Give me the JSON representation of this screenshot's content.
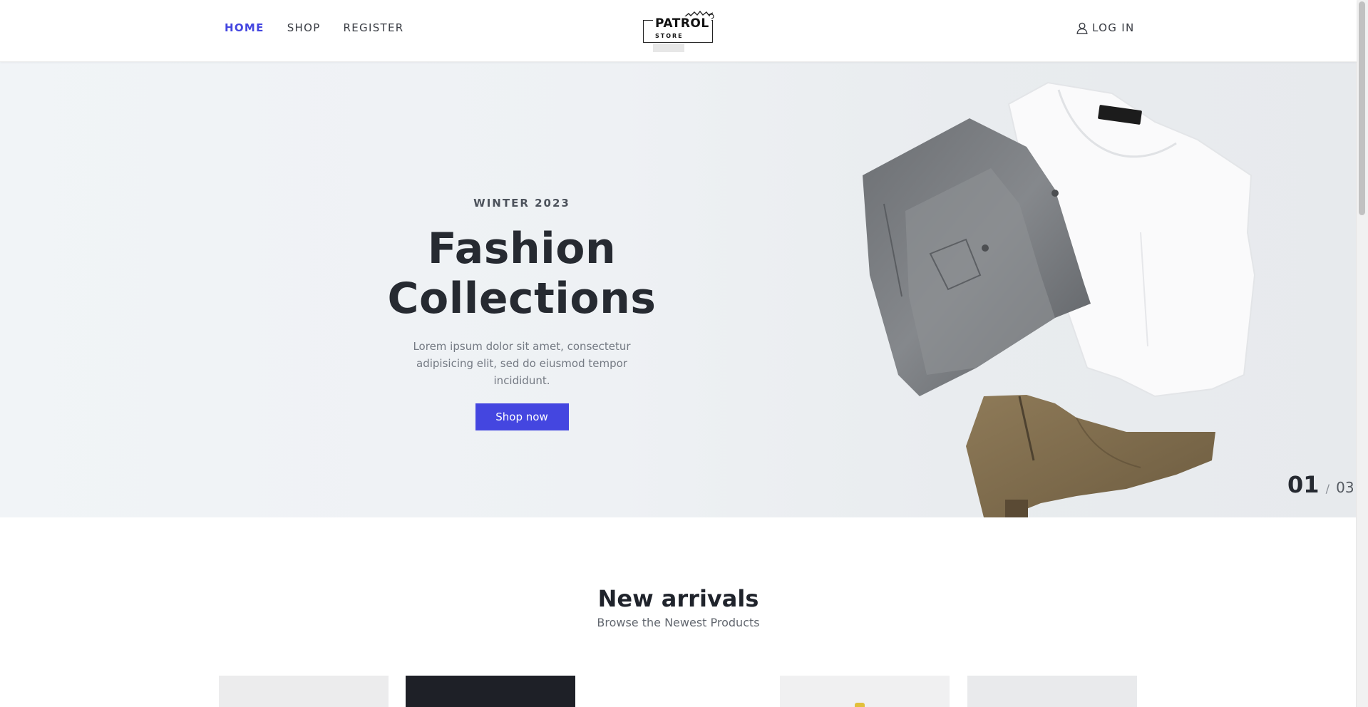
{
  "nav": {
    "items": [
      {
        "label": "HOME",
        "active": true
      },
      {
        "label": "SHOP",
        "active": false
      },
      {
        "label": "REGISTER",
        "active": false
      }
    ],
    "login_label": "LOG IN"
  },
  "logo": {
    "title": "PATROL",
    "subtitle": "STORE"
  },
  "hero": {
    "eyebrow": "WINTER 2023",
    "title": "Fashion Collections",
    "text": "Lorem ipsum dolor sit amet, consectetur adipisicing elit, sed do eiusmod tempor incididunt.",
    "button_label": "Shop now",
    "slide_current": "01",
    "slide_separator": "/",
    "slide_total": "03"
  },
  "arrivals": {
    "title": "New arrivals",
    "subtitle": "Browse the Newest Products"
  },
  "colors": {
    "accent": "#4446e0",
    "text_dark": "#262a31",
    "text_muted": "#747a83"
  },
  "icons": {
    "login": "user-icon",
    "logo_ornament": "birds-icon"
  }
}
